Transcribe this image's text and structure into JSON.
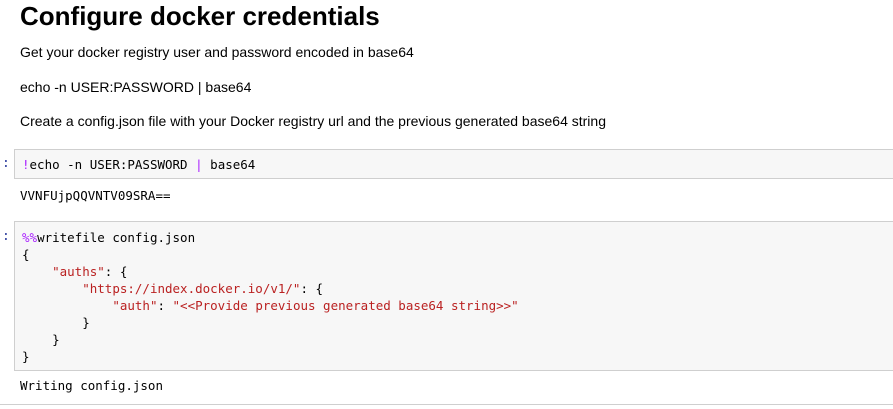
{
  "markdown": {
    "title": "Configure docker credentials",
    "para1": "Get your docker registry user and password encoded in base64",
    "para2": "echo -n USER:PASSWORD | base64",
    "para3": "Create a config.json file with your Docker registry url and the previous generated base64 string"
  },
  "cell1": {
    "prompt": ":",
    "code": {
      "bang": "!",
      "cmd": "echo -n USER:PASSWORD ",
      "pipe": "|",
      "rest": " base64"
    },
    "output": "VVNFUjpQQVNTV09SRA=="
  },
  "cell2": {
    "prompt": ":",
    "lines": {
      "l1_magic": "%%",
      "l1_rest": "writefile config.json",
      "l2": "{",
      "l3_indent": "    ",
      "l3_key": "\"auths\"",
      "l3_rest": ": {",
      "l4_indent": "        ",
      "l4_key": "\"https://index.docker.io/v1/\"",
      "l4_rest": ": {",
      "l5_indent": "            ",
      "l5_key": "\"auth\"",
      "l5_mid": ": ",
      "l5_val": "\"<<Provide previous generated base64 string>>\"",
      "l6": "        }",
      "l7": "    }",
      "l8": "}"
    },
    "output": "Writing config.json"
  }
}
